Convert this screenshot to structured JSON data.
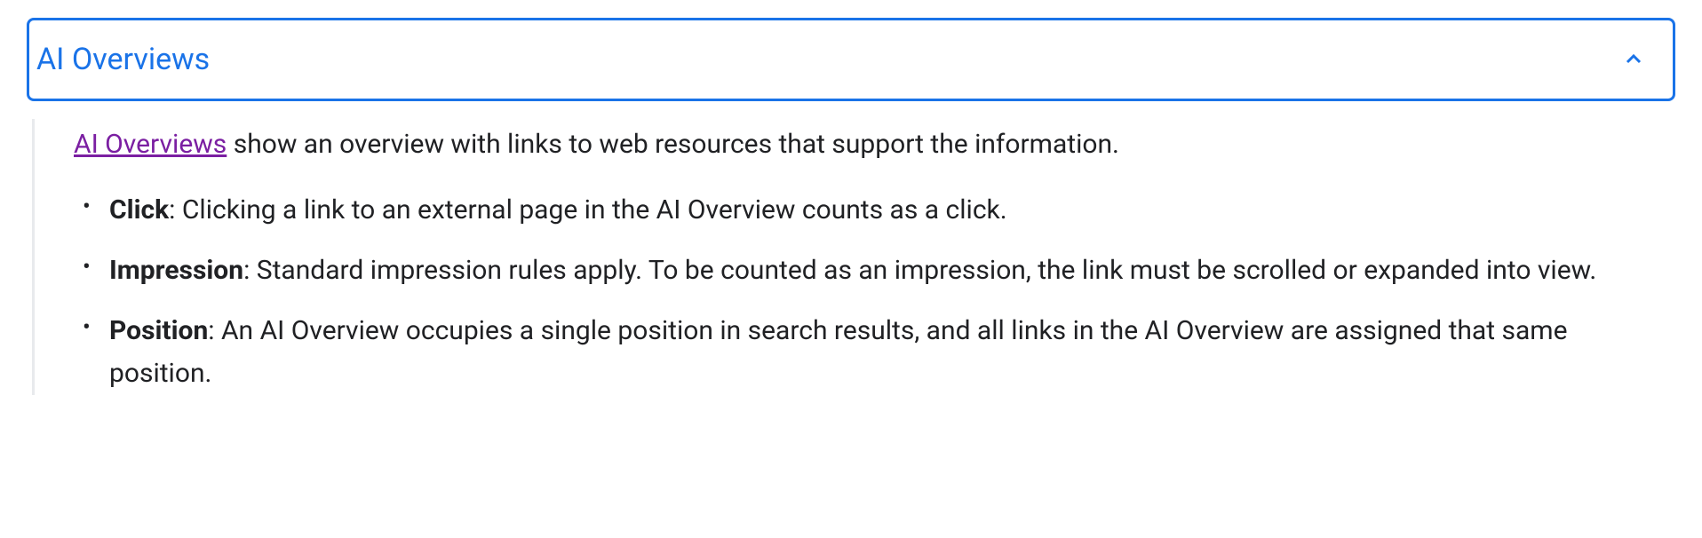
{
  "accordion": {
    "title": "AI Overviews"
  },
  "intro": {
    "linkText": "AI Overviews",
    "restText": " show an overview with links to web resources that support the information."
  },
  "bullets": [
    {
      "label": "Click",
      "text": ": Clicking a link to an external page in the AI Overview counts as a click."
    },
    {
      "label": "Impression",
      "text": ": Standard impression rules apply. To be counted as an impression, the link must be scrolled or expanded into view."
    },
    {
      "label": "Position",
      "text": ": An AI Overview occupies a single position in search results, and all links in the AI Overview are assigned that same position."
    }
  ]
}
